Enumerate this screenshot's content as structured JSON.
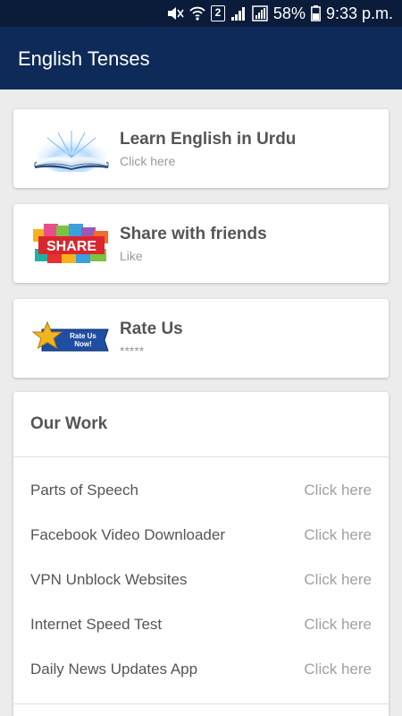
{
  "status_bar": {
    "battery_percent": "58%",
    "time": "9:33 p.m.",
    "sim_label": "2"
  },
  "app_bar": {
    "title": "English Tenses"
  },
  "cards": [
    {
      "title": "Learn English in Urdu",
      "subtitle": "Click here",
      "icon": "open-book-icon"
    },
    {
      "title": "Share with friends",
      "subtitle": "Like",
      "icon": "share-badge-icon",
      "image_text": "SHARE"
    },
    {
      "title": "Rate Us",
      "subtitle": "*****",
      "icon": "rate-us-star-icon",
      "image_text": "Rate Us Now!"
    }
  ],
  "our_work": {
    "title": "Our Work",
    "items": [
      {
        "name": "Parts of Speech",
        "action": "Click here"
      },
      {
        "name": "Facebook Video Downloader",
        "action": "Click here"
      },
      {
        "name": "VPN Unblock Websites",
        "action": "Click here"
      },
      {
        "name": "Internet Speed Test",
        "action": "Click here"
      },
      {
        "name": "Daily News Updates App",
        "action": "Click here"
      }
    ]
  },
  "colors": {
    "status_bar": "#0b1c3a",
    "app_bar": "#0d2a58",
    "background": "#ececec",
    "title_text": "#555555",
    "muted_text": "#a0a0a0"
  }
}
